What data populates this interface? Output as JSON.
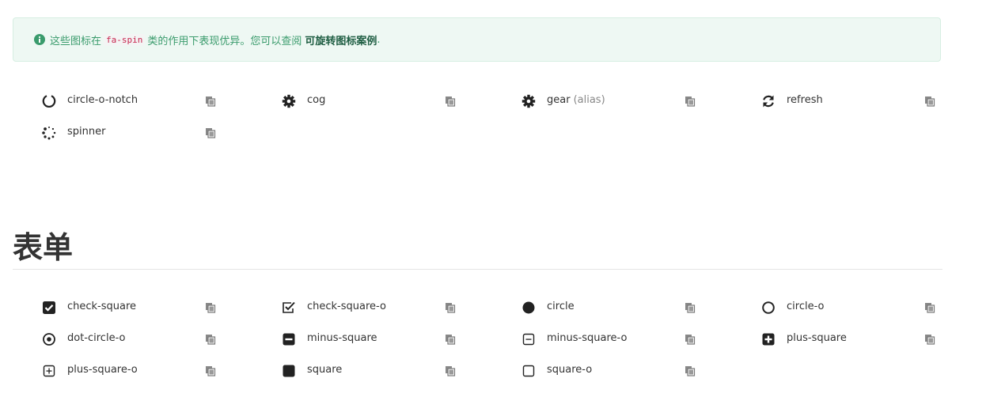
{
  "alert": {
    "text_before": "这些图标在",
    "code": "fa-spin",
    "text_after": "类的作用下表现优异。您可以查阅",
    "link": "可旋转图标案例",
    "period": "."
  },
  "spinner_icons": [
    {
      "name": "circle-o-notch",
      "icon": "circle-o-notch-icon"
    },
    {
      "name": "cog",
      "icon": "cog-icon"
    },
    {
      "name": "gear",
      "alias": "(alias)",
      "icon": "gear-icon"
    },
    {
      "name": "refresh",
      "icon": "refresh-icon"
    },
    {
      "name": "spinner",
      "icon": "spinner-icon"
    }
  ],
  "section_title": "表单",
  "form_icons": [
    {
      "name": "check-square",
      "icon": "check-square-icon"
    },
    {
      "name": "check-square-o",
      "icon": "check-square-o-icon"
    },
    {
      "name": "circle",
      "icon": "circle-icon"
    },
    {
      "name": "circle-o",
      "icon": "circle-o-icon"
    },
    {
      "name": "dot-circle-o",
      "icon": "dot-circle-o-icon"
    },
    {
      "name": "minus-square",
      "icon": "minus-square-icon"
    },
    {
      "name": "minus-square-o",
      "icon": "minus-square-o-icon"
    },
    {
      "name": "plus-square",
      "icon": "plus-square-icon"
    },
    {
      "name": "plus-square-o",
      "icon": "plus-square-o-icon"
    },
    {
      "name": "square",
      "icon": "square-icon"
    },
    {
      "name": "square-o",
      "icon": "square-o-icon"
    }
  ],
  "colors": {
    "accent": "#3a9b6c",
    "alert_bg": "#eef8f3",
    "text": "#333333"
  }
}
